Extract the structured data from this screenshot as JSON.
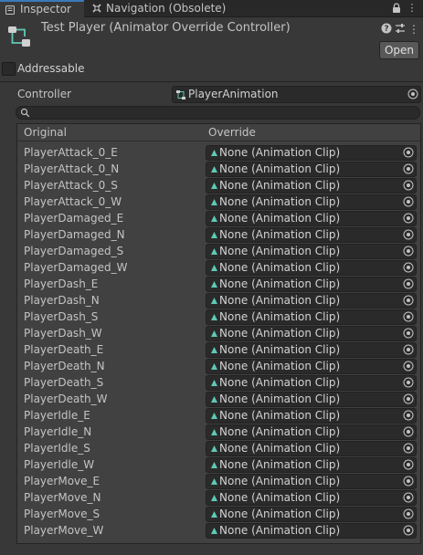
{
  "tabs": [
    {
      "label": "Inspector",
      "icon": "info-icon",
      "active": true
    },
    {
      "label": "Navigation (Obsolete)",
      "icon": "navigation-icon",
      "active": false
    }
  ],
  "tab_buttons": {
    "lock": "lock-icon",
    "menu": "more-options-icon"
  },
  "header": {
    "title": "Test Player (Animator Override Controller)",
    "open_label": "Open",
    "icons": [
      "help-icon",
      "preset-icon",
      "more-options-icon"
    ]
  },
  "addressable": {
    "label": "Addressable",
    "checked": false
  },
  "controller": {
    "label": "Controller",
    "value": "PlayerAnimation"
  },
  "search": {
    "placeholder": ""
  },
  "table": {
    "col_original": "Original",
    "col_override": "Override",
    "rows": [
      {
        "original": "PlayerAttack_0_E",
        "override": "None (Animation Clip)"
      },
      {
        "original": "PlayerAttack_0_N",
        "override": "None (Animation Clip)"
      },
      {
        "original": "PlayerAttack_0_S",
        "override": "None (Animation Clip)"
      },
      {
        "original": "PlayerAttack_0_W",
        "override": "None (Animation Clip)"
      },
      {
        "original": "PlayerDamaged_E",
        "override": "None (Animation Clip)"
      },
      {
        "original": "PlayerDamaged_N",
        "override": "None (Animation Clip)"
      },
      {
        "original": "PlayerDamaged_S",
        "override": "None (Animation Clip)"
      },
      {
        "original": "PlayerDamaged_W",
        "override": "None (Animation Clip)"
      },
      {
        "original": "PlayerDash_E",
        "override": "None (Animation Clip)"
      },
      {
        "original": "PlayerDash_N",
        "override": "None (Animation Clip)"
      },
      {
        "original": "PlayerDash_S",
        "override": "None (Animation Clip)"
      },
      {
        "original": "PlayerDash_W",
        "override": "None (Animation Clip)"
      },
      {
        "original": "PlayerDeath_E",
        "override": "None (Animation Clip)"
      },
      {
        "original": "PlayerDeath_N",
        "override": "None (Animation Clip)"
      },
      {
        "original": "PlayerDeath_S",
        "override": "None (Animation Clip)"
      },
      {
        "original": "PlayerDeath_W",
        "override": "None (Animation Clip)"
      },
      {
        "original": "PlayerIdle_E",
        "override": "None (Animation Clip)"
      },
      {
        "original": "PlayerIdle_N",
        "override": "None (Animation Clip)"
      },
      {
        "original": "PlayerIdle_S",
        "override": "None (Animation Clip)"
      },
      {
        "original": "PlayerIdle_W",
        "override": "None (Animation Clip)"
      },
      {
        "original": "PlayerMove_E",
        "override": "None (Animation Clip)"
      },
      {
        "original": "PlayerMove_N",
        "override": "None (Animation Clip)"
      },
      {
        "original": "PlayerMove_S",
        "override": "None (Animation Clip)"
      },
      {
        "original": "PlayerMove_W",
        "override": "None (Animation Clip)"
      }
    ]
  },
  "colors": {
    "accent": "#3a79bb",
    "clip_icon": "#5fc9b6",
    "background": "#383838"
  }
}
